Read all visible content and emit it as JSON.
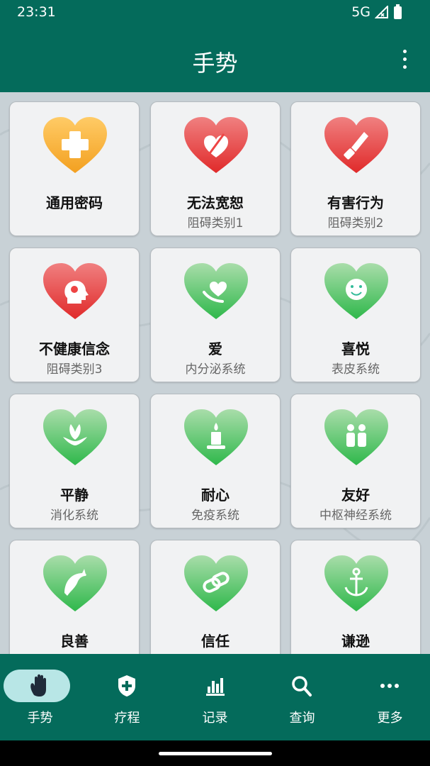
{
  "status": {
    "time": "23:31",
    "network": "5G"
  },
  "appbar": {
    "title": "手势"
  },
  "cards": [
    {
      "name": "通用密码",
      "sub": "",
      "color": "orange",
      "icon": "plus-icon"
    },
    {
      "name": "无法宽恕",
      "sub": "阻碍类别1",
      "color": "red",
      "icon": "broken-heart-icon"
    },
    {
      "name": "有害行为",
      "sub": "阻碍类别2",
      "color": "red",
      "icon": "knife-icon"
    },
    {
      "name": "不健康信念",
      "sub": "阻碍类别3",
      "color": "red",
      "icon": "head-icon"
    },
    {
      "name": "爱",
      "sub": "内分泌系统",
      "color": "green",
      "icon": "heart-hand-icon"
    },
    {
      "name": "喜悦",
      "sub": "表皮系统",
      "color": "green",
      "icon": "smile-icon"
    },
    {
      "name": "平静",
      "sub": "消化系统",
      "color": "green",
      "icon": "lotus-icon"
    },
    {
      "name": "耐心",
      "sub": "免疫系统",
      "color": "green",
      "icon": "candle-icon"
    },
    {
      "name": "友好",
      "sub": "中枢神经系统",
      "color": "green",
      "icon": "people-icon"
    },
    {
      "name": "良善",
      "sub": "",
      "color": "green",
      "icon": "dolphin-icon"
    },
    {
      "name": "信任",
      "sub": "",
      "color": "green",
      "icon": "link-icon"
    },
    {
      "name": "谦逊",
      "sub": "",
      "color": "green",
      "icon": "anchor-icon"
    }
  ],
  "nav": [
    {
      "label": "手势",
      "icon": "hand-icon",
      "active": true
    },
    {
      "label": "疗程",
      "icon": "shield-plus-icon",
      "active": false
    },
    {
      "label": "记录",
      "icon": "bar-chart-icon",
      "active": false
    },
    {
      "label": "查询",
      "icon": "search-icon",
      "active": false
    },
    {
      "label": "更多",
      "icon": "more-horizontal-icon",
      "active": false
    }
  ],
  "colors": {
    "primary": "#046b5b",
    "orange_top": "#ffcb66",
    "orange_bottom": "#f3a020",
    "red_top": "#f08080",
    "red_bottom": "#e02a2a",
    "green_top": "#a9ddaa",
    "green_bottom": "#2fb84b",
    "active_pill": "#b8e6e6"
  }
}
